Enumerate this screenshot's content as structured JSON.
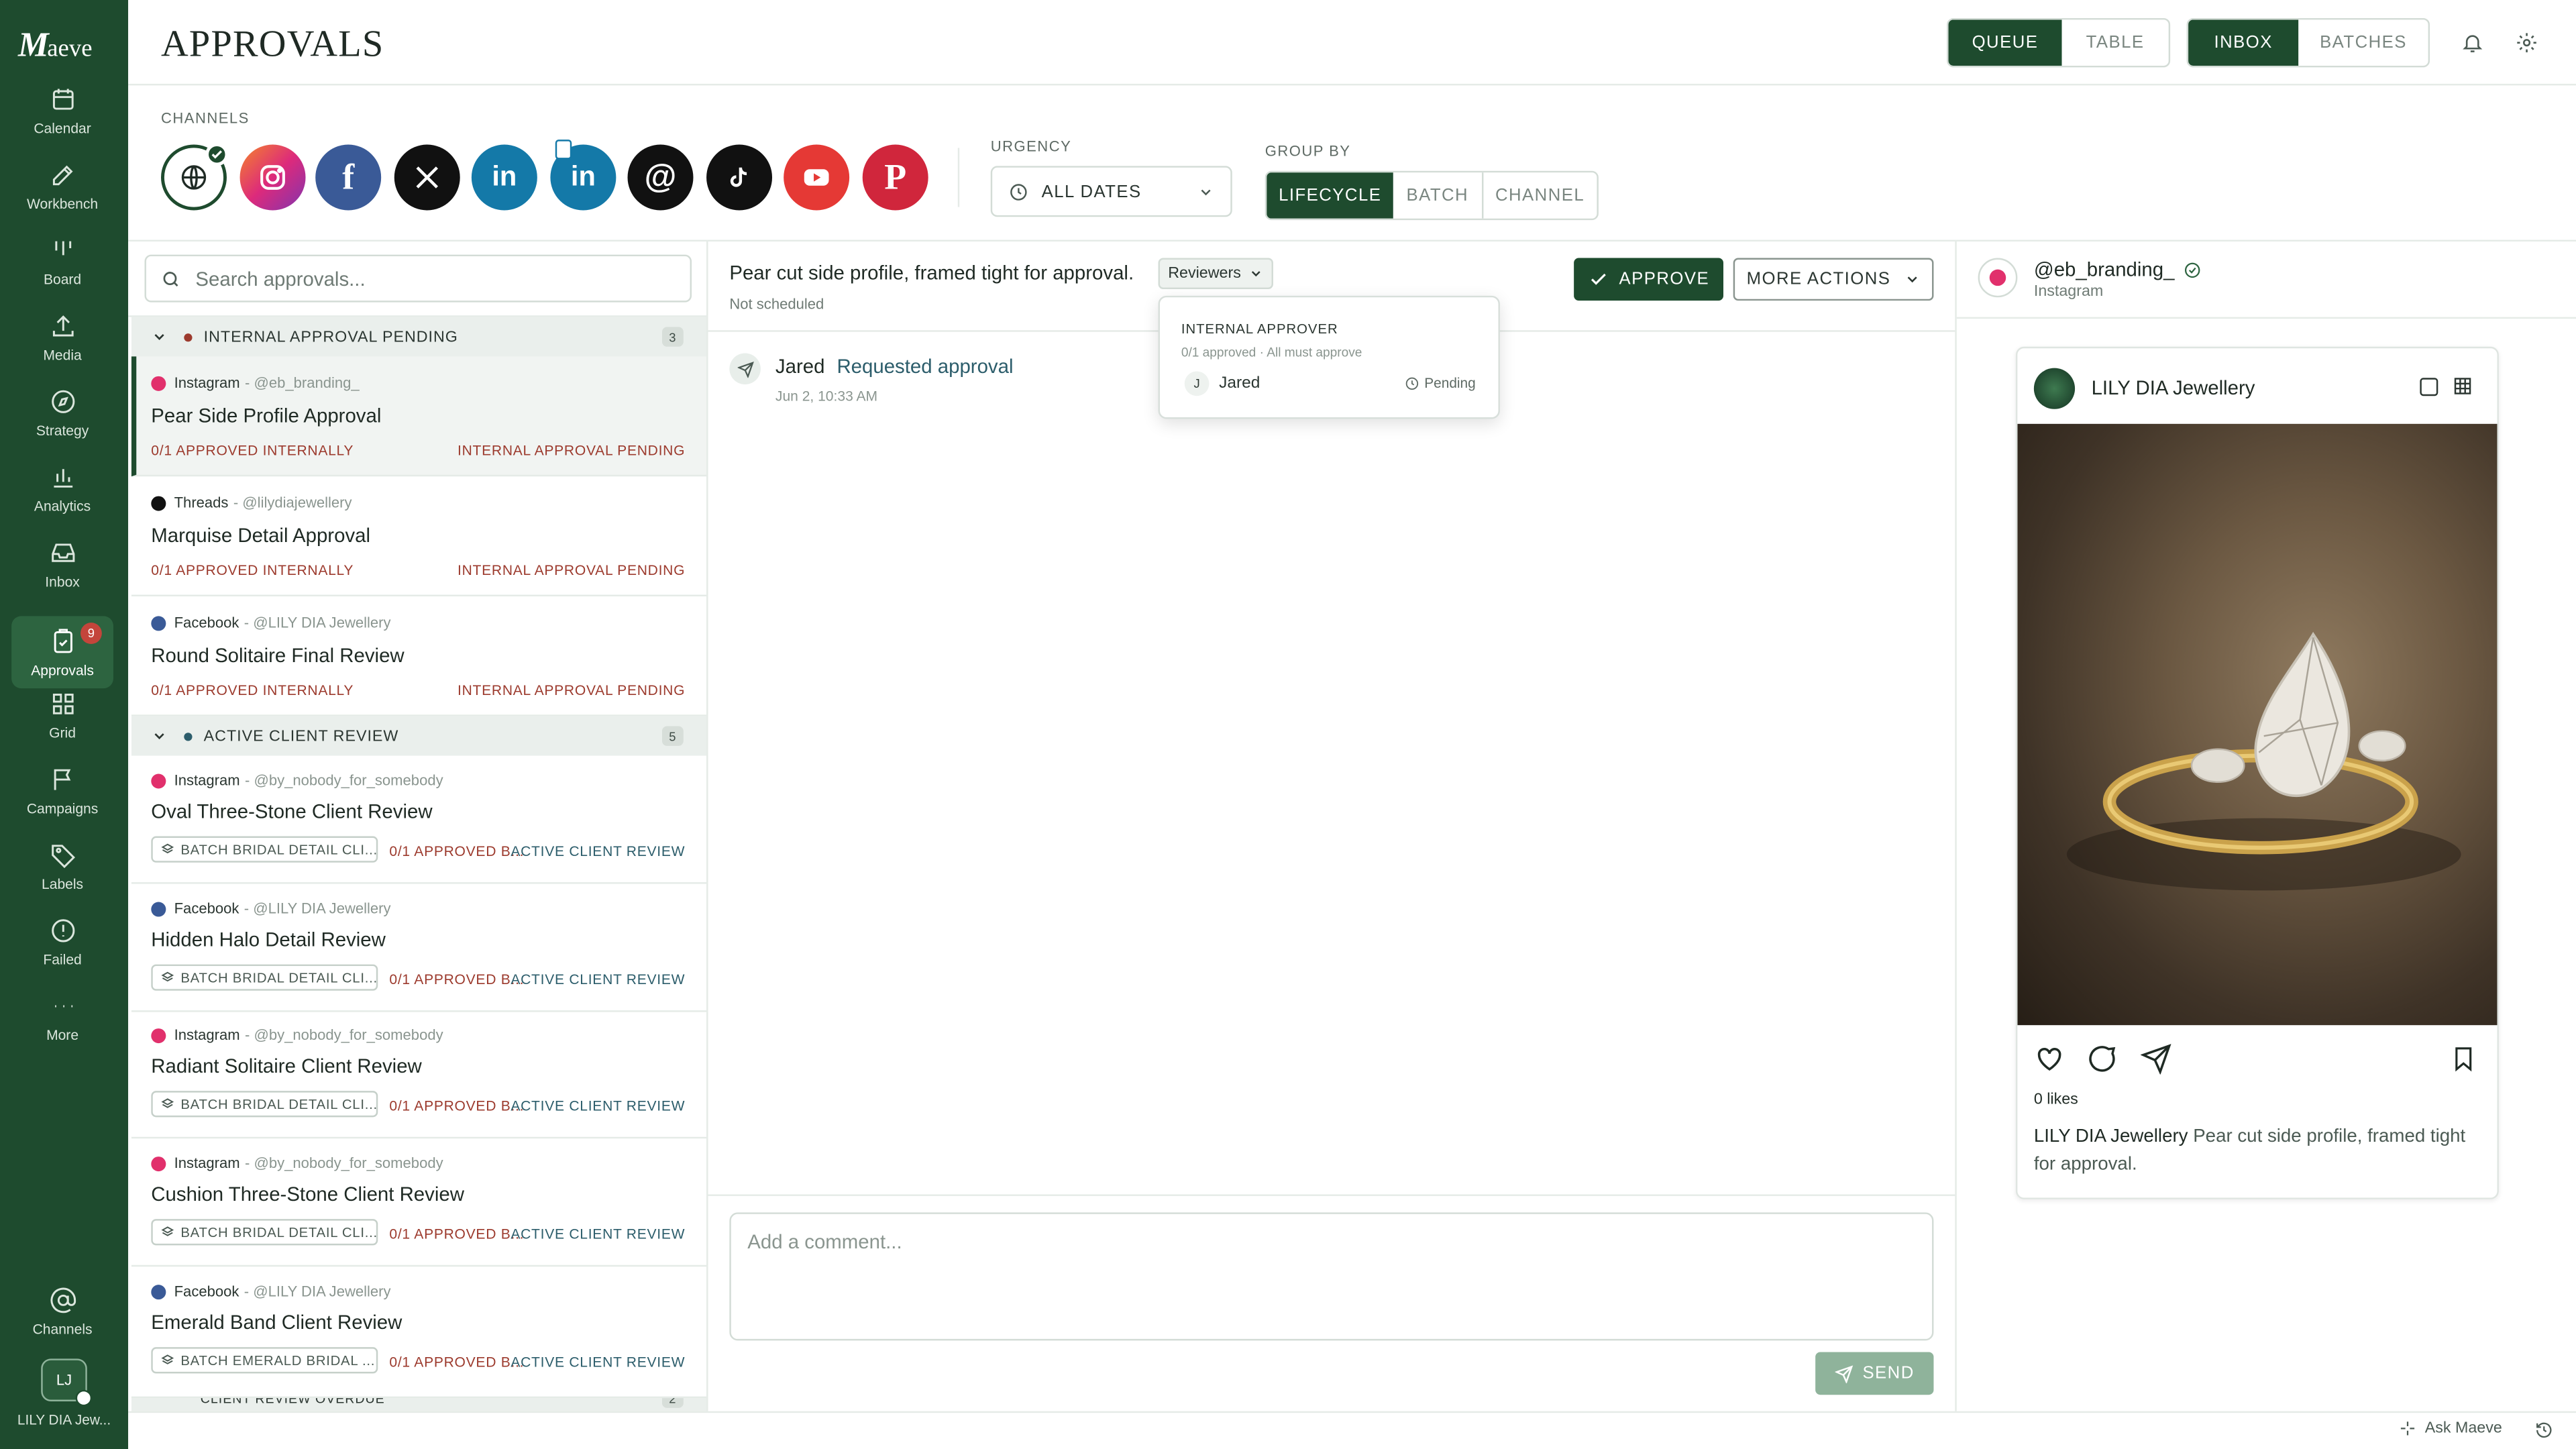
{
  "brand": {
    "logo_letter": "M",
    "logo_rest": "aeve"
  },
  "nav": [
    {
      "label": "Calendar",
      "icon": "calendar-icon"
    },
    {
      "label": "Workbench",
      "icon": "edit-icon"
    },
    {
      "label": "Board",
      "icon": "board-icon"
    },
    {
      "label": "Media",
      "icon": "upload-icon"
    },
    {
      "label": "Strategy",
      "icon": "compass-icon"
    },
    {
      "label": "Analytics",
      "icon": "bar-chart-icon"
    },
    {
      "label": "Inbox",
      "icon": "inbox-icon"
    },
    {
      "label": "Approvals",
      "icon": "clipboard-check-icon",
      "badge": "9"
    },
    {
      "label": "Grid",
      "icon": "grid-icon"
    },
    {
      "label": "Campaigns",
      "icon": "flag-icon"
    },
    {
      "label": "Labels",
      "icon": "tag-icon"
    },
    {
      "label": "Failed",
      "icon": "alert-circle-icon"
    },
    {
      "label": "More",
      "icon": "more-icon"
    }
  ],
  "nav_bottom": {
    "channels": "Channels",
    "account_initials": "LJ",
    "account_name": "LILY DIA Jew..."
  },
  "header": {
    "title": "APPROVALS",
    "view_toggle": [
      "QUEUE",
      "TABLE"
    ],
    "mode_toggle": [
      "INBOX",
      "BATCHES"
    ]
  },
  "filters": {
    "channels_label": "CHANNELS",
    "urgency_label": "URGENCY",
    "urgency_value": "ALL DATES",
    "group_by_label": "GROUP BY",
    "group_by": [
      "LIFECYCLE",
      "BATCH",
      "CHANNEL"
    ]
  },
  "colors": {
    "brand_green": "#1e4b2e",
    "instagram": "#e1306c",
    "facebook": "#3a5a97",
    "linkedin": "#1479a8",
    "youtube": "#e53935",
    "pinterest": "#d0263c"
  },
  "search": {
    "placeholder": "Search approvals..."
  },
  "groups": [
    {
      "label": "INTERNAL APPROVAL PENDING",
      "count": "3"
    },
    {
      "label": "ACTIVE CLIENT REVIEW",
      "count": "5"
    },
    {
      "label": "CLIENT REVIEW OVERDUE",
      "count": "2"
    }
  ],
  "items": [
    {
      "network": "Instagram",
      "handle": "@eb_branding_",
      "title": "Pear Side Profile Approval",
      "left": "0/1 APPROVED INTERNALLY",
      "right": "INTERNAL APPROVAL PENDING"
    },
    {
      "network": "Threads",
      "handle": "@lilydiajewellery",
      "title": "Marquise Detail Approval",
      "left": "0/1 APPROVED INTERNALLY",
      "right": "INTERNAL APPROVAL PENDING"
    },
    {
      "network": "Facebook",
      "handle": "@LILY DIA Jewellery",
      "title": "Round Solitaire Final Review",
      "left": "0/1 APPROVED INTERNALLY",
      "right": "INTERNAL APPROVAL PENDING"
    },
    {
      "network": "Instagram",
      "handle": "@by_nobody_for_somebody",
      "title": "Oval Three-Stone Client Review",
      "batch": "BATCH BRIDAL DETAIL CLI...",
      "left": "0/1 APPROVED B...",
      "right": "ACTIVE CLIENT REVIEW"
    },
    {
      "network": "Facebook",
      "handle": "@LILY DIA Jewellery",
      "title": "Hidden Halo Detail Review",
      "batch": "BATCH BRIDAL DETAIL CLI...",
      "left": "0/1 APPROVED B...",
      "right": "ACTIVE CLIENT REVIEW"
    },
    {
      "network": "Instagram",
      "handle": "@by_nobody_for_somebody",
      "title": "Radiant Solitaire Client Review",
      "batch": "BATCH BRIDAL DETAIL CLI...",
      "left": "0/1 APPROVED B...",
      "right": "ACTIVE CLIENT REVIEW"
    },
    {
      "network": "Instagram",
      "handle": "@by_nobody_for_somebody",
      "title": "Cushion Three-Stone Client Review",
      "batch": "BATCH BRIDAL DETAIL CLI...",
      "left": "0/1 APPROVED B...",
      "right": "ACTIVE CLIENT REVIEW"
    },
    {
      "network": "Facebook",
      "handle": "@LILY DIA Jewellery",
      "title": "Emerald Band Client Review",
      "batch": "BATCH EMERALD BRIDAL ...",
      "left": "0/1 APPROVED B...",
      "right": "ACTIVE CLIENT REVIEW"
    }
  ],
  "detail": {
    "caption": "Pear cut side profile, framed tight for approval.",
    "reviewers_label": "Reviewers",
    "schedule": "Not scheduled",
    "approve": "APPROVE",
    "more_actions": "MORE ACTIONS",
    "popover": {
      "heading": "INTERNAL APPROVER",
      "sub": "0/1 approved · All must approve",
      "initial": "J",
      "name": "Jared",
      "status": "Pending"
    },
    "activity": {
      "actor": "Jared",
      "action": "Requested approval",
      "time": "Jun 2, 10:33 AM"
    },
    "comment_placeholder": "Add a comment...",
    "send": "SEND"
  },
  "preview": {
    "account": "@eb_branding_",
    "network": "Instagram",
    "page_name": "LILY DIA Jewellery",
    "likes": "0 likes",
    "caption_author": "LILY DIA Jewellery",
    "caption": "Pear cut side profile, framed tight for approval."
  },
  "footer": {
    "ask": "Ask Maeve"
  }
}
